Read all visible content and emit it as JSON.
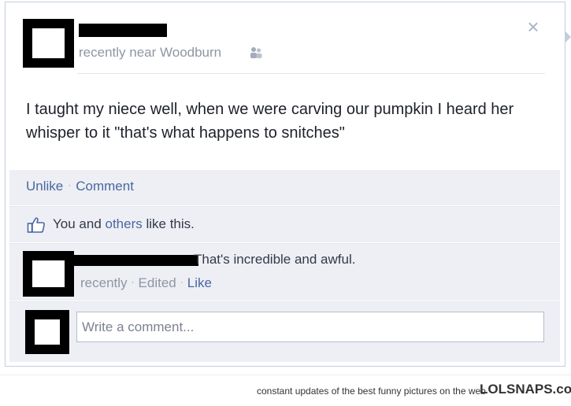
{
  "post": {
    "meta": "recently near Woodburn",
    "text": "I taught my niece well, when we were carving our pumpkin I heard her whisper to it \"that's what happens to snitches\"",
    "close_glyph": "×",
    "privacy_icon": "friends-icon"
  },
  "actions": {
    "unlike": "Unlike",
    "comment": "Comment",
    "separator": "·"
  },
  "likes": {
    "icon": "thumbs-up-icon",
    "prefix": "You and ",
    "others_link": "others",
    "suffix": " like this."
  },
  "comment": {
    "text": "That's incredible and awful.",
    "time": "recently",
    "edited": "Edited",
    "like": "Like"
  },
  "composer": {
    "placeholder": "Write a comment..."
  },
  "footer": {
    "tagline": "constant updates of the best funny pictures on the web",
    "brand": "LOLSNAPS.com"
  },
  "colors": {
    "link": "#4b67a1",
    "panel": "#edeff4",
    "border": "#c4cde0"
  }
}
